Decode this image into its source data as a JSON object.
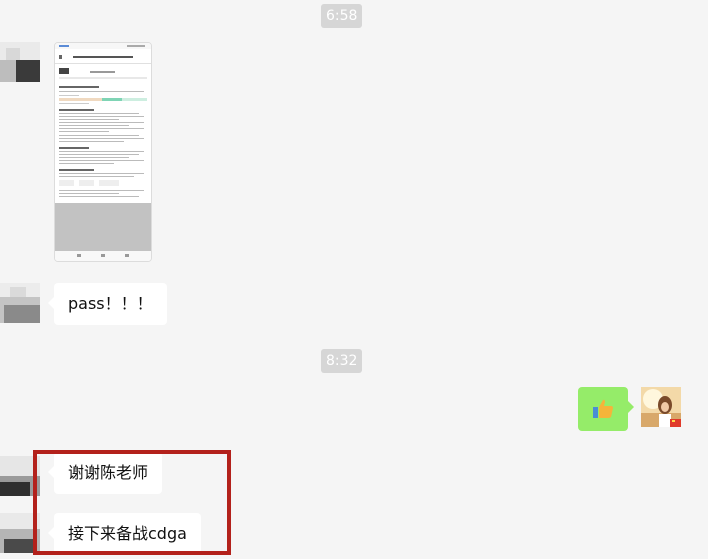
{
  "chat": {
    "timestamp_1": "6:58",
    "timestamp_2": "8:32",
    "messages": [
      {
        "from": "other",
        "type": "image",
        "description_icon": "document-screenshot"
      },
      {
        "from": "other",
        "type": "text",
        "text": "pass！！！"
      },
      {
        "from": "self",
        "type": "emoji",
        "icon": "thumbs-up-icon"
      },
      {
        "from": "other",
        "type": "text",
        "text": "谢谢陈老师"
      },
      {
        "from": "other",
        "type": "text",
        "text": "接下来备战cdga"
      }
    ]
  },
  "screenshot_thumb": {
    "header": "1/1 d9509afd-3005-445a-9...",
    "status_left": "中国移动",
    "status_right": "5 Jul 09:"
  },
  "colors": {
    "background": "#f5f5f5",
    "self_bubble": "#95ec69",
    "highlight_box": "#b3211b"
  }
}
